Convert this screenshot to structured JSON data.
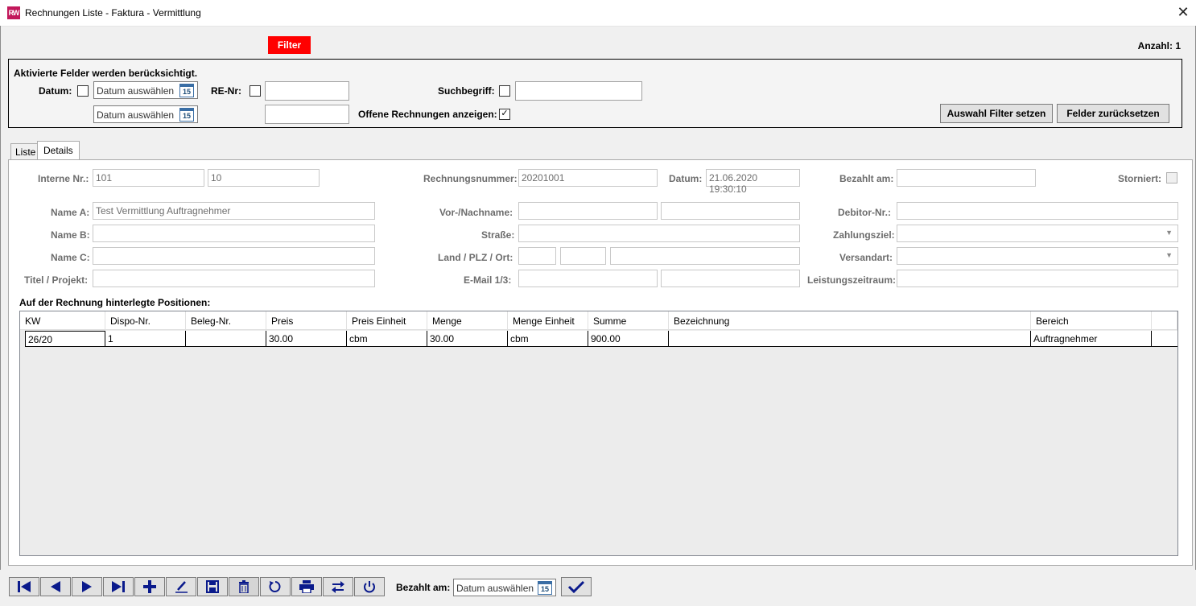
{
  "window": {
    "title": "Rechnungen Liste - Faktura - Vermittlung",
    "icon_text": "RW"
  },
  "filter": {
    "button_label": "Filter",
    "count_text": "Anzahl: 1",
    "hint": "Aktivierte Felder werden berücksichtigt.",
    "datum_label": "Datum:",
    "date_from_placeholder": "Datum auswählen",
    "date_to_placeholder": "Datum auswählen",
    "renr_label": "RE-Nr:",
    "suchbegriff_label": "Suchbegriff:",
    "offene_label": "Offene Rechnungen anzeigen:",
    "offene_checked": true,
    "apply_label": "Auswahl Filter setzen",
    "reset_label": "Felder zurücksetzen",
    "calendar_day": "15"
  },
  "tabs": [
    {
      "label": "Liste"
    },
    {
      "label": "Details"
    }
  ],
  "details": {
    "interne_nr_label": "Interne Nr.:",
    "interne_nr_1": "101",
    "interne_nr_2": "10",
    "rechnungsnummer_label": "Rechnungsnummer:",
    "rechnungsnummer": "20201001",
    "datum_label": "Datum:",
    "datum": "21.06.2020 19:30:10",
    "bezahlt_am_label": "Bezahlt am:",
    "bezahlt_am": "",
    "storniert_label": "Storniert:",
    "name_a_label": "Name A:",
    "name_a": "Test Vermittlung Auftragnehmer",
    "name_b_label": "Name B:",
    "name_c_label": "Name C:",
    "titel_label": "Titel / Projekt:",
    "vorname_label": "Vor-/Nachname:",
    "strasse_label": "Straße:",
    "land_label": "Land / PLZ / Ort:",
    "email_label": "E-Mail 1/3:",
    "debitor_label": "Debitor-Nr.:",
    "zahlungsziel_label": "Zahlungsziel:",
    "versandart_label": "Versandart:",
    "leistung_label": "Leistungszeitraum:",
    "positions_label": "Auf der Rechnung hinterlegte Positionen:"
  },
  "grid": {
    "columns": [
      "KW",
      "Dispo-Nr.",
      "Beleg-Nr.",
      "Preis",
      "Preis Einheit",
      "Menge",
      "Menge Einheit",
      "Summe",
      "Bezeichnung",
      "Bereich"
    ],
    "rows": [
      [
        "26/20",
        "1",
        "",
        "30.00",
        "cbm",
        "30.00",
        "cbm",
        "900.00",
        "",
        "Auftragnehmer"
      ]
    ]
  },
  "bottom": {
    "bezahlt_label": "Bezahlt am:",
    "date_placeholder": "Datum auswählen",
    "calendar_day": "15"
  },
  "toolbar_icons": [
    "first-icon",
    "prev-icon",
    "next-icon",
    "last-icon",
    "add-icon",
    "edit-icon",
    "save-icon",
    "delete-icon",
    "refresh-icon",
    "print-icon",
    "transfer-icon",
    "power-icon",
    "confirm-icon"
  ],
  "colors": {
    "filter_red": "#ff0000",
    "nav_blue": "#0a1a8c"
  }
}
